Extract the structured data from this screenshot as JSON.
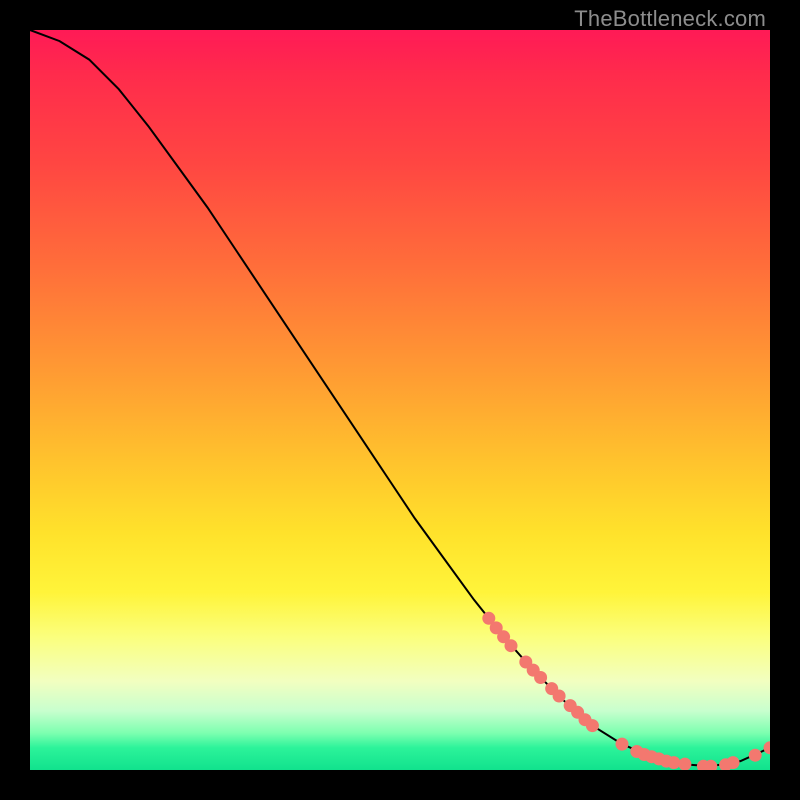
{
  "attribution": "TheBottleneck.com",
  "chart_data": {
    "type": "line",
    "title": "",
    "xlabel": "",
    "ylabel": "",
    "xlim": [
      0,
      100
    ],
    "ylim": [
      0,
      100
    ],
    "series": [
      {
        "name": "curve",
        "x": [
          0,
          4,
          8,
          12,
          16,
          20,
          24,
          28,
          32,
          36,
          40,
          44,
          48,
          52,
          56,
          60,
          64,
          68,
          72,
          76,
          80,
          84,
          88,
          92,
          96,
          100
        ],
        "y": [
          100,
          98.5,
          96,
          92,
          87,
          81.5,
          76,
          70,
          64,
          58,
          52,
          46,
          40,
          34,
          28.5,
          23,
          18,
          13.5,
          9.5,
          6,
          3.5,
          1.8,
          0.8,
          0.5,
          1.2,
          3
        ]
      }
    ],
    "markers": [
      {
        "x": 62,
        "y": 20.5
      },
      {
        "x": 63,
        "y": 19.2
      },
      {
        "x": 64,
        "y": 18.0
      },
      {
        "x": 65,
        "y": 16.8
      },
      {
        "x": 67,
        "y": 14.6
      },
      {
        "x": 68,
        "y": 13.5
      },
      {
        "x": 69,
        "y": 12.5
      },
      {
        "x": 70.5,
        "y": 11.0
      },
      {
        "x": 71.5,
        "y": 10.0
      },
      {
        "x": 73,
        "y": 8.7
      },
      {
        "x": 74,
        "y": 7.8
      },
      {
        "x": 75,
        "y": 6.8
      },
      {
        "x": 76,
        "y": 6.0
      },
      {
        "x": 80,
        "y": 3.5
      },
      {
        "x": 82,
        "y": 2.5
      },
      {
        "x": 83,
        "y": 2.1
      },
      {
        "x": 84,
        "y": 1.8
      },
      {
        "x": 85,
        "y": 1.5
      },
      {
        "x": 86,
        "y": 1.2
      },
      {
        "x": 87,
        "y": 1.0
      },
      {
        "x": 88.5,
        "y": 0.8
      },
      {
        "x": 91,
        "y": 0.5
      },
      {
        "x": 92,
        "y": 0.5
      },
      {
        "x": 94,
        "y": 0.7
      },
      {
        "x": 95,
        "y": 1.0
      },
      {
        "x": 98,
        "y": 2.0
      },
      {
        "x": 100,
        "y": 3.0
      }
    ],
    "colors": {
      "curve": "#000000",
      "marker_fill": "#f3786f",
      "marker_stroke": "#f3786f"
    }
  }
}
